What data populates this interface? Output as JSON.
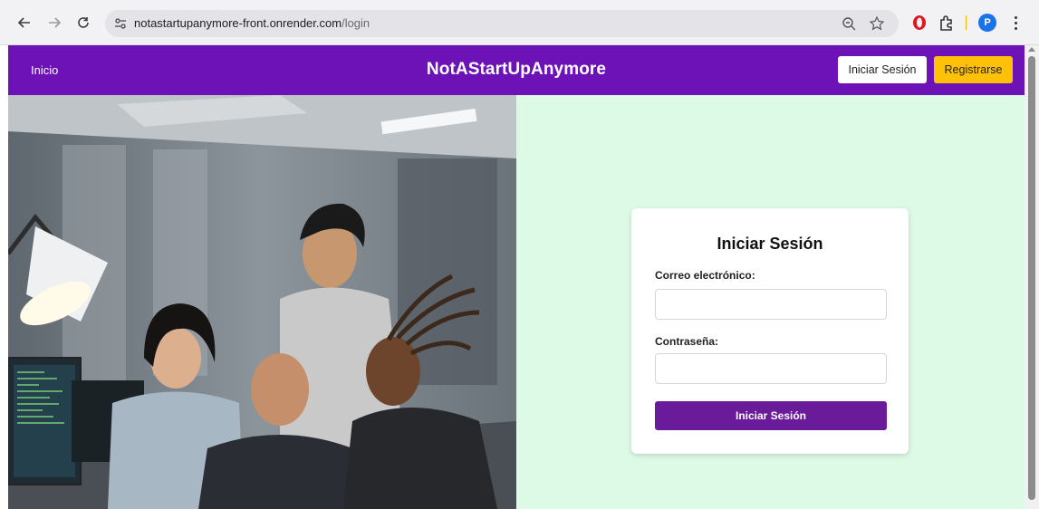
{
  "browser": {
    "url_host": "notastartupanymore-front.onrender.com",
    "url_path": "/login",
    "profile_initial": "P"
  },
  "navbar": {
    "home_label": "Inicio",
    "brand": "NotAStartUpAnymore",
    "login_label": "Iniciar Sesión",
    "register_label": "Registrarse"
  },
  "login": {
    "title": "Iniciar Sesión",
    "email_label": "Correo electrónico:",
    "email_value": "",
    "password_label": "Contraseña:",
    "password_value": "",
    "submit_label": "Iniciar Sesión"
  },
  "colors": {
    "navbar": "#6d12b7",
    "register_button": "#ffc107",
    "right_panel": "#dcfae6",
    "submit_button": "#6a1b9a"
  }
}
